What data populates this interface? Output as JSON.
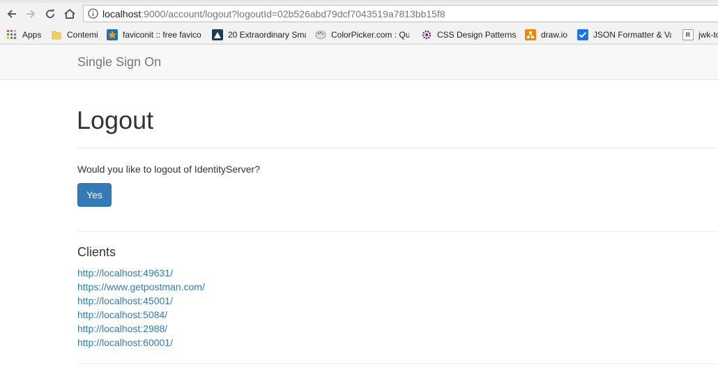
{
  "browser": {
    "url_host": "localhost",
    "url_rest": ":9000/account/logout?logoutId=02b526abd79dcf7043519a7813bb15f8",
    "bookmarks": [
      {
        "label": "Apps",
        "icon": "apps-grid-icon"
      },
      {
        "label": "Contemi",
        "icon": "folder-icon"
      },
      {
        "label": "faviconit :: free favico",
        "icon": "star-icon"
      },
      {
        "label": "20 Extraordinary Sma",
        "icon": "site-icon"
      },
      {
        "label": "ColorPicker.com : Qu",
        "icon": "palette-icon"
      },
      {
        "label": "CSS Design Patterns",
        "icon": "gear-icon"
      },
      {
        "label": "draw.io",
        "icon": "drawio-icon"
      },
      {
        "label": "JSON Formatter & Va",
        "icon": "check-icon"
      },
      {
        "label": "jwk-to",
        "icon": "r-icon"
      }
    ]
  },
  "navbar": {
    "brand": "Single Sign On"
  },
  "main": {
    "title": "Logout",
    "question": "Would you like to logout of IdentityServer?",
    "yes_label": "Yes",
    "clients_title": "Clients",
    "clients": [
      "http://localhost:49631/",
      "https://www.getpostman.com/",
      "http://localhost:45001/",
      "http://localhost:5084/",
      "http://localhost:2988/",
      "http://localhost:60001/"
    ]
  },
  "colors": {
    "primary": "#337ab7",
    "link": "#337ab7",
    "navbar_bg": "#f8f8f8"
  }
}
